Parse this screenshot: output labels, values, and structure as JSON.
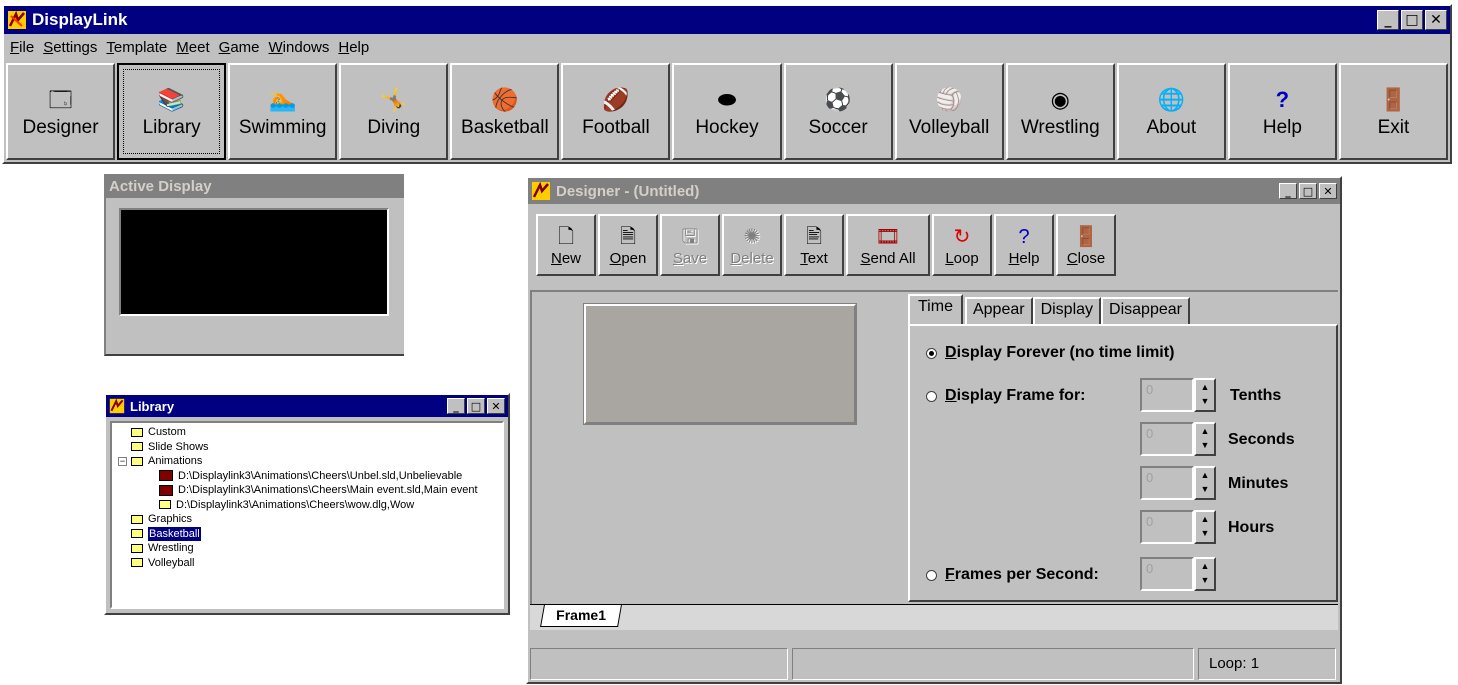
{
  "main_window": {
    "title": "DisplayLink",
    "menu": [
      "File",
      "Settings",
      "Template",
      "Meet",
      "Game",
      "Windows",
      "Help"
    ],
    "toolbar": [
      {
        "label": "Designer",
        "icon": "designer-icon",
        "glyph": "🗔"
      },
      {
        "label": "Library",
        "icon": "library-icon",
        "glyph": "📚",
        "pressed": true
      },
      {
        "label": "Swimming",
        "icon": "swimming-icon",
        "glyph": "🏊"
      },
      {
        "label": "Diving",
        "icon": "diving-icon",
        "glyph": "🤸"
      },
      {
        "label": "Basketball",
        "icon": "basketball-icon",
        "glyph": "🏀"
      },
      {
        "label": "Football",
        "icon": "football-icon",
        "glyph": "🏈"
      },
      {
        "label": "Hockey",
        "icon": "hockey-icon",
        "glyph": "⬬"
      },
      {
        "label": "Soccer",
        "icon": "soccer-icon",
        "glyph": "⚽"
      },
      {
        "label": "Volleyball",
        "icon": "volleyball-icon",
        "glyph": "🏐"
      },
      {
        "label": "Wrestling",
        "icon": "wrestling-icon",
        "glyph": "◉"
      },
      {
        "label": "About",
        "icon": "globe-icon",
        "glyph": "🌐"
      },
      {
        "label": "Help",
        "icon": "help-icon",
        "glyph": "?"
      },
      {
        "label": "Exit",
        "icon": "exit-icon",
        "glyph": "🚪"
      }
    ]
  },
  "active_display": {
    "title": "Active Display"
  },
  "library": {
    "title": "Library",
    "tree": [
      {
        "label": "Custom",
        "kind": "folder",
        "depth": 0
      },
      {
        "label": "Slide Shows",
        "kind": "folder",
        "depth": 0
      },
      {
        "label": "Animations",
        "kind": "folder",
        "depth": 0,
        "expanded": true
      },
      {
        "label": "D:\\Displaylink3\\Animations\\Cheers\\Unbel.sld,Unbelievable",
        "kind": "film",
        "depth": 1
      },
      {
        "label": "D:\\Displaylink3\\Animations\\Cheers\\Main event.sld,Main event",
        "kind": "film",
        "depth": 1
      },
      {
        "label": "D:\\Displaylink3\\Animations\\Cheers\\wow.dlg,Wow",
        "kind": "folder",
        "depth": 1
      },
      {
        "label": "Graphics",
        "kind": "folder",
        "depth": 0
      },
      {
        "label": "Basketball",
        "kind": "folder",
        "depth": 0,
        "selected": true
      },
      {
        "label": "Wrestling",
        "kind": "folder",
        "depth": 0
      },
      {
        "label": "Volleyball",
        "kind": "folder",
        "depth": 0
      }
    ]
  },
  "designer": {
    "title": "Designer - (Untitled)",
    "toolbar": [
      {
        "label": "New",
        "icon": "new-icon",
        "glyph": "🗋",
        "enabled": true
      },
      {
        "label": "Open",
        "icon": "open-icon",
        "glyph": "🗎",
        "enabled": true
      },
      {
        "label": "Save",
        "icon": "save-icon",
        "glyph": "🖫",
        "enabled": false
      },
      {
        "label": "Delete",
        "icon": "delete-icon",
        "glyph": "✺",
        "enabled": false
      },
      {
        "label": "Text",
        "icon": "text-icon",
        "glyph": "🖹",
        "enabled": true
      },
      {
        "label": "Send All",
        "icon": "send-all-icon",
        "glyph": "🎞",
        "enabled": true,
        "wide": true
      },
      {
        "label": "Loop",
        "icon": "loop-icon",
        "glyph": "↻",
        "enabled": true
      },
      {
        "label": "Help",
        "icon": "help-icon",
        "glyph": "?",
        "enabled": true
      },
      {
        "label": "Close",
        "icon": "close-door-icon",
        "glyph": "🚪",
        "enabled": true
      }
    ],
    "tabs": [
      "Time",
      "Appear",
      "Display",
      "Disappear"
    ],
    "active_tab": "Time",
    "time_panel": {
      "display_forever": "Display Forever (no time limit)",
      "display_frame_for": "Display Frame for:",
      "frames_per_second": "Frames per Second:",
      "units": [
        "Tenths",
        "Seconds",
        "Minutes",
        "Hours"
      ],
      "spin_value": "0"
    },
    "frame_tab": "Frame1",
    "status": {
      "loop": "Loop:  1"
    }
  }
}
